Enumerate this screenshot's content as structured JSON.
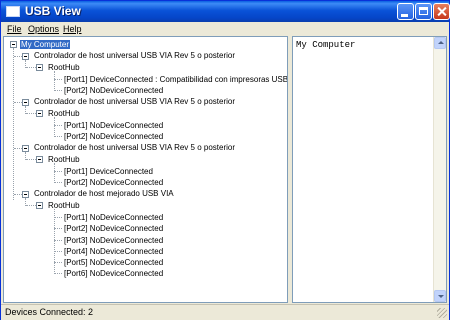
{
  "window": {
    "title": "USB View",
    "icon": "window-app-icon"
  },
  "menu": {
    "file": "File",
    "options": "Options",
    "help": "Help"
  },
  "tree": {
    "root": "My Computer",
    "controllers": [
      {
        "label": "Controlador de host universal USB VIA Rev 5 o posterior",
        "hub": "RootHub",
        "ports": [
          "[Port1] DeviceConnected :  Compatibilidad con impresoras USB",
          "[Port2] NoDeviceConnected"
        ]
      },
      {
        "label": "Controlador de host universal USB VIA Rev 5 o posterior",
        "hub": "RootHub",
        "ports": [
          "[Port1] NoDeviceConnected",
          "[Port2] NoDeviceConnected"
        ]
      },
      {
        "label": "Controlador de host universal USB VIA Rev 5 o posterior",
        "hub": "RootHub",
        "ports": [
          "[Port1] DeviceConnected",
          "[Port2] NoDeviceConnected"
        ]
      },
      {
        "label": "Controlador de host mejorado USB VIA",
        "hub": "RootHub",
        "ports": [
          "[Port1] NoDeviceConnected",
          "[Port2] NoDeviceConnected",
          "[Port3] NoDeviceConnected",
          "[Port4] NoDeviceConnected",
          "[Port5] NoDeviceConnected",
          "[Port6] NoDeviceConnected"
        ]
      }
    ]
  },
  "detail": {
    "text": "My Computer"
  },
  "status": {
    "text": "Devices Connected: 2"
  },
  "colors": {
    "titlebar": "#0a53d8",
    "selection": "#316ac5",
    "window": "#ece9d8"
  }
}
